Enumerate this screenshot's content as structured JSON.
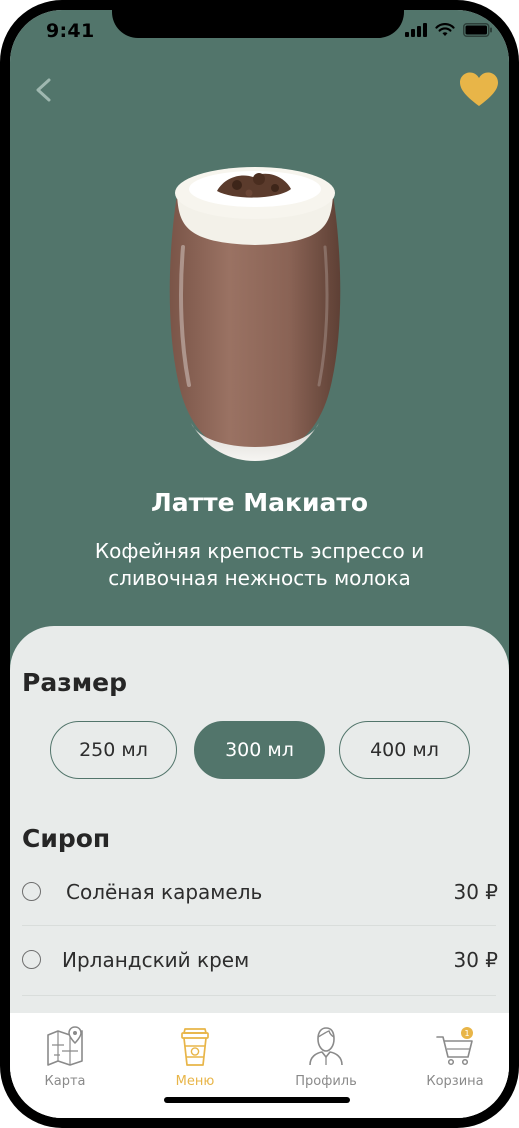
{
  "status": {
    "time": "9:41"
  },
  "product": {
    "name": "Латте Макиато",
    "description_line1": "Кофейняя крепость эспрессо и",
    "description_line2": "сливочная нежность молока"
  },
  "size": {
    "title": "Размер",
    "options": [
      "250 мл",
      "300 мл",
      "400 мл"
    ],
    "selected": "300 мл"
  },
  "syrup": {
    "title": "Сироп",
    "items": [
      {
        "name": "Солёная карамель",
        "price": "30 ₽"
      },
      {
        "name": "Ирландский крем",
        "price": "30 ₽"
      }
    ]
  },
  "tabs": [
    {
      "label": "Карта",
      "icon": "map-icon"
    },
    {
      "label": "Меню",
      "icon": "coffee-cup-icon",
      "active": true
    },
    {
      "label": "Профиль",
      "icon": "user-icon"
    },
    {
      "label": "Корзина",
      "icon": "cart-icon",
      "badge": "1"
    }
  ],
  "colors": {
    "primary": "#52756b",
    "accent": "#e8b548",
    "sheet": "#e8ebea"
  }
}
